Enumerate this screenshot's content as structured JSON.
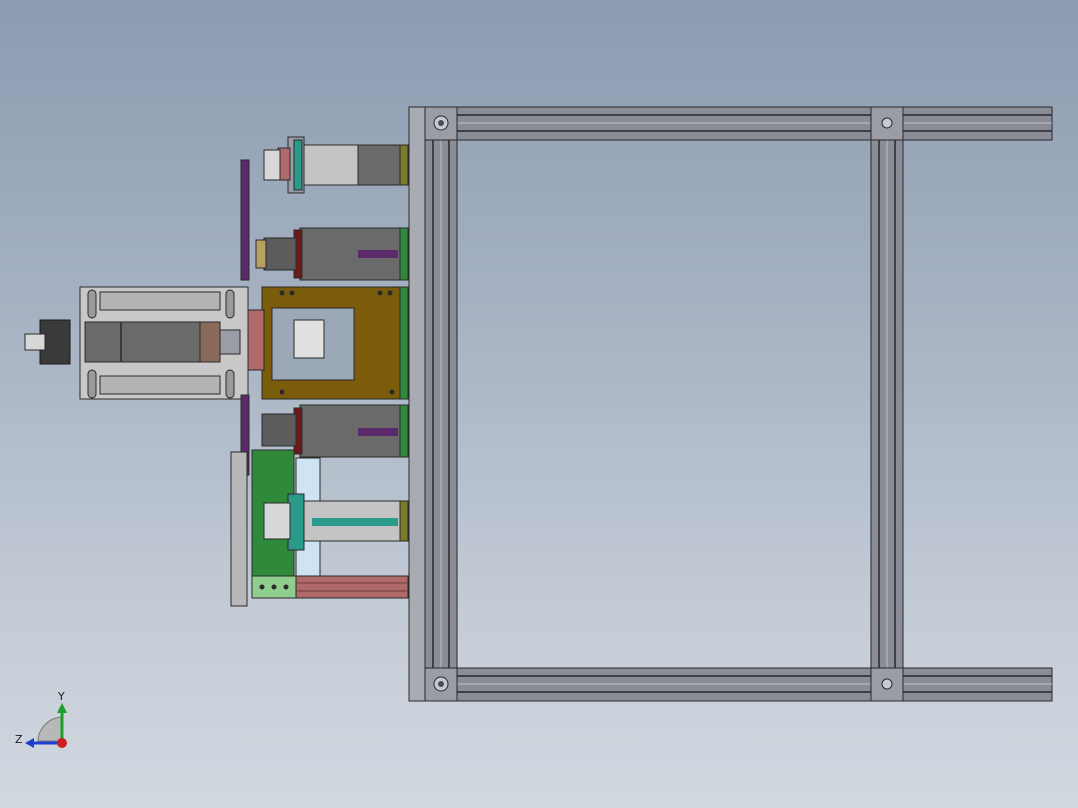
{
  "viewport": {
    "background_top": "#8b9bb0",
    "background_bottom": "#d2d8e0"
  },
  "model": {
    "description_icon": "cad-assembly-top-view",
    "colors": {
      "frame": "#8a8c96",
      "frame_dark": "#5a5c66",
      "frame_slot": "#3e4048",
      "base_plate": "#c8c8c8",
      "bronze_block": "#7a5c0a",
      "motor_grey": "#6a6a6a",
      "purple_part": "#5a2a6a",
      "green_part": "#2e8a3a",
      "red_bar": "#b06a6a",
      "teal_part": "#2a9a8a",
      "olive_part": "#7a7a2a",
      "light_blue": "#cfe4f2"
    }
  },
  "triad": {
    "x_label": "",
    "y_label": "Y",
    "z_label": "Z",
    "y_color": "#1e9e2a",
    "z_color": "#1e3ed0",
    "origin_color": "#d01e1e"
  }
}
